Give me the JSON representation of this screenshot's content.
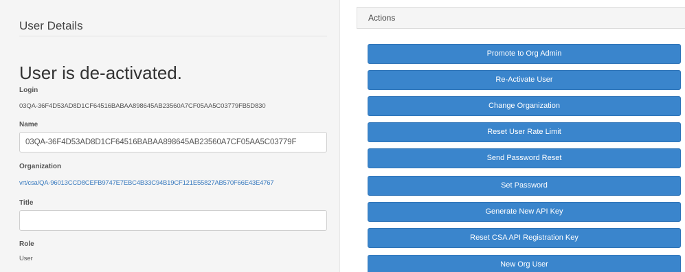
{
  "user_details": {
    "panel_title": "User Details",
    "status_heading": "User is de-activated.",
    "login_label": "Login",
    "login_value": "03QA-36F4D53AD8D1CF64516BABAA898645AB23560A7CF05AA5C03779FB5D830",
    "name_label": "Name",
    "name_value": "03QA-36F4D53AD8D1CF64516BABAA898645AB23560A7CF05AA5C03779F",
    "organization_label": "Organization",
    "organization_value": "vrt/csa/QA-96013CCD8CEFB9747E7EBC4B33C94B19CF121E55827AB570F66E43E4767",
    "title_label": "Title",
    "title_value": "",
    "role_label": "Role",
    "role_value": "User"
  },
  "actions": {
    "panel_title": "Actions",
    "buttons": [
      {
        "label": "Promote to Org Admin"
      },
      {
        "label": "Re-Activate User"
      },
      {
        "label": "Change Organization"
      },
      {
        "label": "Reset User Rate Limit"
      },
      {
        "label": "Send Password Reset"
      },
      {
        "label": "Set Password"
      },
      {
        "label": "Generate New API Key"
      },
      {
        "label": "Reset CSA API Registration Key"
      },
      {
        "label": "New Org User"
      }
    ]
  },
  "colors": {
    "button_primary": "#3a85cc",
    "link": "#3a7bbf",
    "panel_background": "#f5f5f5"
  }
}
